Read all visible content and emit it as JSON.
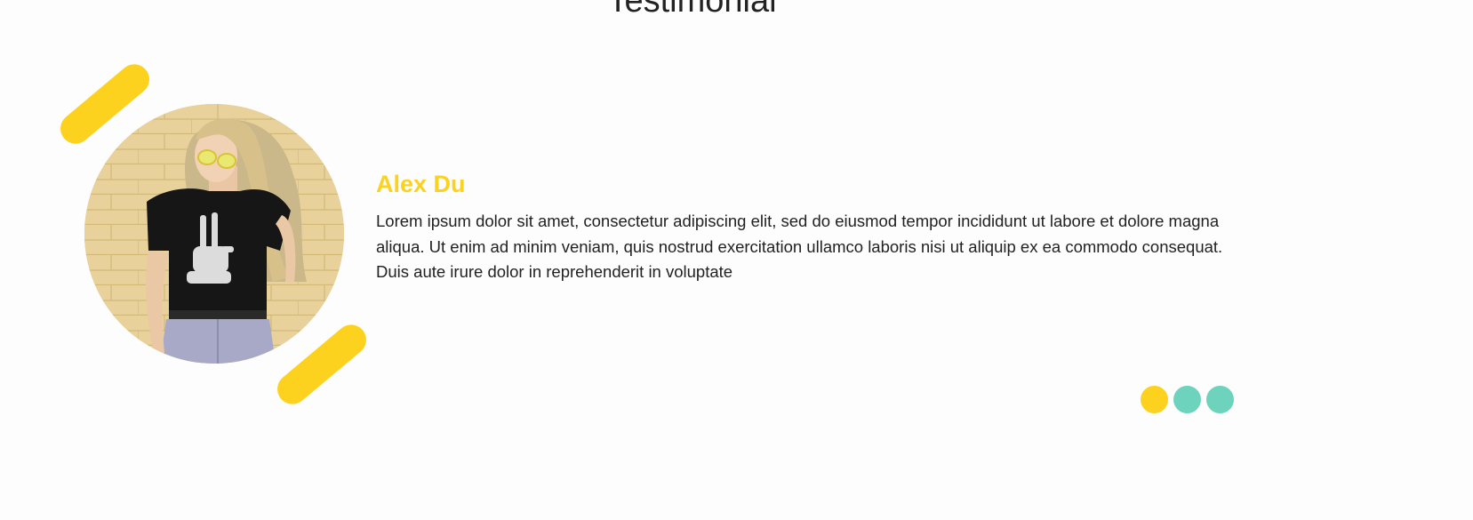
{
  "section": {
    "title": "Testimonial"
  },
  "testimonial": {
    "name": "Alex Du",
    "quote": "Lorem ipsum dolor sit amet, consectetur adipiscing elit, sed do eiusmod tempor incididunt ut labore et dolore magna aliqua. Ut enim ad minim veniam, quis nostrud exercitation ullamco laboris nisi ut aliquip ex ea commodo consequat. Duis aute irure dolor in reprehenderit in voluptate",
    "avatar_icon": "woman-portrait-photo"
  },
  "slider": {
    "active_index": 0,
    "count": 3
  },
  "colors": {
    "accent_yellow": "#fdd21f",
    "dot_teal": "#6dd3bd",
    "text": "#222222",
    "background": "#fdfdfd"
  }
}
